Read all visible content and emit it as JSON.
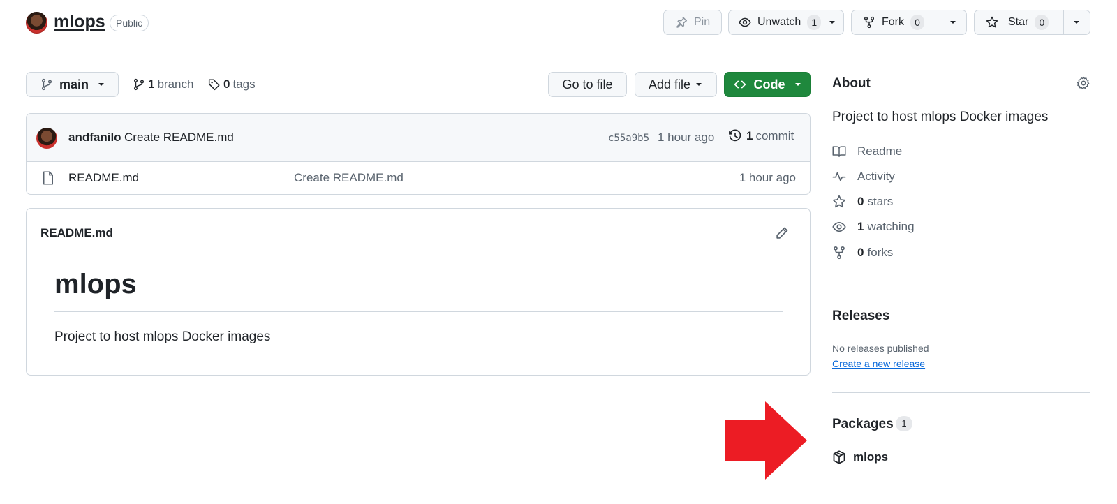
{
  "repo": {
    "name": "mlops",
    "visibility": "Public"
  },
  "header_actions": {
    "pin_label": "Pin",
    "unwatch_label": "Unwatch",
    "watch_count": "1",
    "fork_label": "Fork",
    "fork_count": "0",
    "star_label": "Star",
    "star_count": "0"
  },
  "toolbar": {
    "branch_name": "main",
    "branch_count": "1",
    "branch_word": "branch",
    "tag_count": "0",
    "tag_word": "tags",
    "go_to_file": "Go to file",
    "add_file": "Add file",
    "code": "Code"
  },
  "latest_commit": {
    "author": "andfanilo",
    "message": "Create README.md",
    "hash": "c55a9b5",
    "time": "1 hour ago",
    "commit_count": "1",
    "commit_word": "commit"
  },
  "files": [
    {
      "name": "README.md",
      "commit_message": "Create README.md",
      "time": "1 hour ago"
    }
  ],
  "readme": {
    "filename": "README.md",
    "heading": "mlops",
    "body": "Project to host mlops Docker images"
  },
  "about": {
    "title": "About",
    "description": "Project to host mlops Docker images",
    "readme_label": "Readme",
    "activity_label": "Activity",
    "stars_count": "0",
    "stars_word": "stars",
    "watching_count": "1",
    "watching_word": "watching",
    "forks_count": "0",
    "forks_word": "forks"
  },
  "releases": {
    "title": "Releases",
    "empty_text": "No releases published",
    "create_link": "Create a new release"
  },
  "packages": {
    "title": "Packages",
    "count": "1",
    "items": [
      "mlops"
    ]
  },
  "colors": {
    "code_button": "#1f883d",
    "link": "#0969da",
    "annotation_arrow": "#ec1c24"
  }
}
